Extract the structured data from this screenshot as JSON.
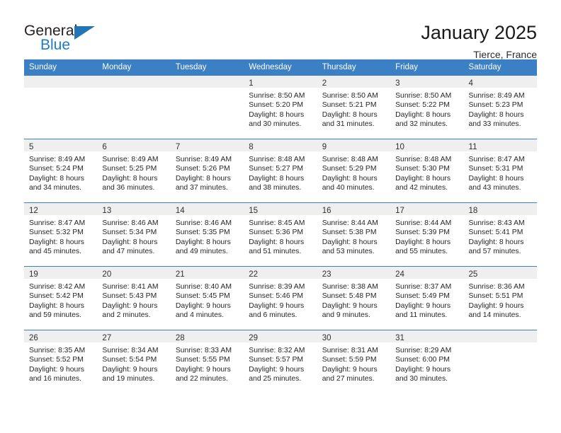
{
  "brand": {
    "word_one": "General",
    "word_two": "Blue",
    "triangle_icon": "triangle-icon"
  },
  "header": {
    "title": "January 2025",
    "location": "Tierce, France"
  },
  "theme": {
    "header_blue": "#3b7fc4",
    "brand_blue": "#1f7bc1",
    "daynum_band": "#efefef",
    "text": "#262626"
  },
  "weekday_headers": [
    "Sunday",
    "Monday",
    "Tuesday",
    "Wednesday",
    "Thursday",
    "Friday",
    "Saturday"
  ],
  "weeks": [
    [
      {
        "day": "",
        "lines": []
      },
      {
        "day": "",
        "lines": []
      },
      {
        "day": "",
        "lines": []
      },
      {
        "day": "1",
        "lines": [
          "Sunrise: 8:50 AM",
          "Sunset: 5:20 PM",
          "Daylight: 8 hours",
          "and 30 minutes."
        ]
      },
      {
        "day": "2",
        "lines": [
          "Sunrise: 8:50 AM",
          "Sunset: 5:21 PM",
          "Daylight: 8 hours",
          "and 31 minutes."
        ]
      },
      {
        "day": "3",
        "lines": [
          "Sunrise: 8:50 AM",
          "Sunset: 5:22 PM",
          "Daylight: 8 hours",
          "and 32 minutes."
        ]
      },
      {
        "day": "4",
        "lines": [
          "Sunrise: 8:49 AM",
          "Sunset: 5:23 PM",
          "Daylight: 8 hours",
          "and 33 minutes."
        ]
      }
    ],
    [
      {
        "day": "5",
        "lines": [
          "Sunrise: 8:49 AM",
          "Sunset: 5:24 PM",
          "Daylight: 8 hours",
          "and 34 minutes."
        ]
      },
      {
        "day": "6",
        "lines": [
          "Sunrise: 8:49 AM",
          "Sunset: 5:25 PM",
          "Daylight: 8 hours",
          "and 36 minutes."
        ]
      },
      {
        "day": "7",
        "lines": [
          "Sunrise: 8:49 AM",
          "Sunset: 5:26 PM",
          "Daylight: 8 hours",
          "and 37 minutes."
        ]
      },
      {
        "day": "8",
        "lines": [
          "Sunrise: 8:48 AM",
          "Sunset: 5:27 PM",
          "Daylight: 8 hours",
          "and 38 minutes."
        ]
      },
      {
        "day": "9",
        "lines": [
          "Sunrise: 8:48 AM",
          "Sunset: 5:29 PM",
          "Daylight: 8 hours",
          "and 40 minutes."
        ]
      },
      {
        "day": "10",
        "lines": [
          "Sunrise: 8:48 AM",
          "Sunset: 5:30 PM",
          "Daylight: 8 hours",
          "and 42 minutes."
        ]
      },
      {
        "day": "11",
        "lines": [
          "Sunrise: 8:47 AM",
          "Sunset: 5:31 PM",
          "Daylight: 8 hours",
          "and 43 minutes."
        ]
      }
    ],
    [
      {
        "day": "12",
        "lines": [
          "Sunrise: 8:47 AM",
          "Sunset: 5:32 PM",
          "Daylight: 8 hours",
          "and 45 minutes."
        ]
      },
      {
        "day": "13",
        "lines": [
          "Sunrise: 8:46 AM",
          "Sunset: 5:34 PM",
          "Daylight: 8 hours",
          "and 47 minutes."
        ]
      },
      {
        "day": "14",
        "lines": [
          "Sunrise: 8:46 AM",
          "Sunset: 5:35 PM",
          "Daylight: 8 hours",
          "and 49 minutes."
        ]
      },
      {
        "day": "15",
        "lines": [
          "Sunrise: 8:45 AM",
          "Sunset: 5:36 PM",
          "Daylight: 8 hours",
          "and 51 minutes."
        ]
      },
      {
        "day": "16",
        "lines": [
          "Sunrise: 8:44 AM",
          "Sunset: 5:38 PM",
          "Daylight: 8 hours",
          "and 53 minutes."
        ]
      },
      {
        "day": "17",
        "lines": [
          "Sunrise: 8:44 AM",
          "Sunset: 5:39 PM",
          "Daylight: 8 hours",
          "and 55 minutes."
        ]
      },
      {
        "day": "18",
        "lines": [
          "Sunrise: 8:43 AM",
          "Sunset: 5:41 PM",
          "Daylight: 8 hours",
          "and 57 minutes."
        ]
      }
    ],
    [
      {
        "day": "19",
        "lines": [
          "Sunrise: 8:42 AM",
          "Sunset: 5:42 PM",
          "Daylight: 8 hours",
          "and 59 minutes."
        ]
      },
      {
        "day": "20",
        "lines": [
          "Sunrise: 8:41 AM",
          "Sunset: 5:43 PM",
          "Daylight: 9 hours",
          "and 2 minutes."
        ]
      },
      {
        "day": "21",
        "lines": [
          "Sunrise: 8:40 AM",
          "Sunset: 5:45 PM",
          "Daylight: 9 hours",
          "and 4 minutes."
        ]
      },
      {
        "day": "22",
        "lines": [
          "Sunrise: 8:39 AM",
          "Sunset: 5:46 PM",
          "Daylight: 9 hours",
          "and 6 minutes."
        ]
      },
      {
        "day": "23",
        "lines": [
          "Sunrise: 8:38 AM",
          "Sunset: 5:48 PM",
          "Daylight: 9 hours",
          "and 9 minutes."
        ]
      },
      {
        "day": "24",
        "lines": [
          "Sunrise: 8:37 AM",
          "Sunset: 5:49 PM",
          "Daylight: 9 hours",
          "and 11 minutes."
        ]
      },
      {
        "day": "25",
        "lines": [
          "Sunrise: 8:36 AM",
          "Sunset: 5:51 PM",
          "Daylight: 9 hours",
          "and 14 minutes."
        ]
      }
    ],
    [
      {
        "day": "26",
        "lines": [
          "Sunrise: 8:35 AM",
          "Sunset: 5:52 PM",
          "Daylight: 9 hours",
          "and 16 minutes."
        ]
      },
      {
        "day": "27",
        "lines": [
          "Sunrise: 8:34 AM",
          "Sunset: 5:54 PM",
          "Daylight: 9 hours",
          "and 19 minutes."
        ]
      },
      {
        "day": "28",
        "lines": [
          "Sunrise: 8:33 AM",
          "Sunset: 5:55 PM",
          "Daylight: 9 hours",
          "and 22 minutes."
        ]
      },
      {
        "day": "29",
        "lines": [
          "Sunrise: 8:32 AM",
          "Sunset: 5:57 PM",
          "Daylight: 9 hours",
          "and 25 minutes."
        ]
      },
      {
        "day": "30",
        "lines": [
          "Sunrise: 8:31 AM",
          "Sunset: 5:59 PM",
          "Daylight: 9 hours",
          "and 27 minutes."
        ]
      },
      {
        "day": "31",
        "lines": [
          "Sunrise: 8:29 AM",
          "Sunset: 6:00 PM",
          "Daylight: 9 hours",
          "and 30 minutes."
        ]
      },
      {
        "day": "",
        "lines": []
      }
    ]
  ]
}
